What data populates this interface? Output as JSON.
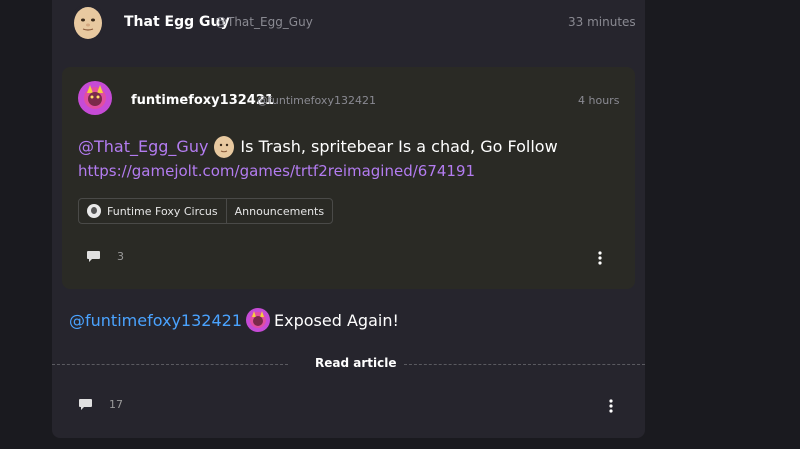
{
  "outer_post": {
    "author_name": "That Egg Guy",
    "author_handle": "@That_Egg_Guy",
    "timestamp": "33 minutes",
    "body_mention": "@funtimefoxy132421",
    "body_text": "Exposed Again!",
    "read_article_label": "Read article",
    "comment_count": "17"
  },
  "quoted_post": {
    "author_name": "funtimefoxy132421",
    "author_handle": "@funtimefoxy132421",
    "timestamp": "4 hours",
    "mention": "@That_Egg_Guy",
    "text": "Is Trash, spritebear Is a chad, Go Follow",
    "link": "https://gamejolt.com/games/trtf2reimagined/674191",
    "tags": [
      "Funtime Foxy Circus",
      "Announcements"
    ],
    "comment_count": "3"
  },
  "colors": {
    "background": "#1a1a1f",
    "card": "#26252d",
    "quoted_card": "#2a2a25",
    "link_purple": "#b37cf0",
    "mention_blue": "#4aa3ff",
    "muted_text": "#8a8a92"
  },
  "icons": [
    "egg-avatar",
    "foxy-avatar",
    "comment-icon",
    "more-vertical-icon",
    "community-icon"
  ]
}
